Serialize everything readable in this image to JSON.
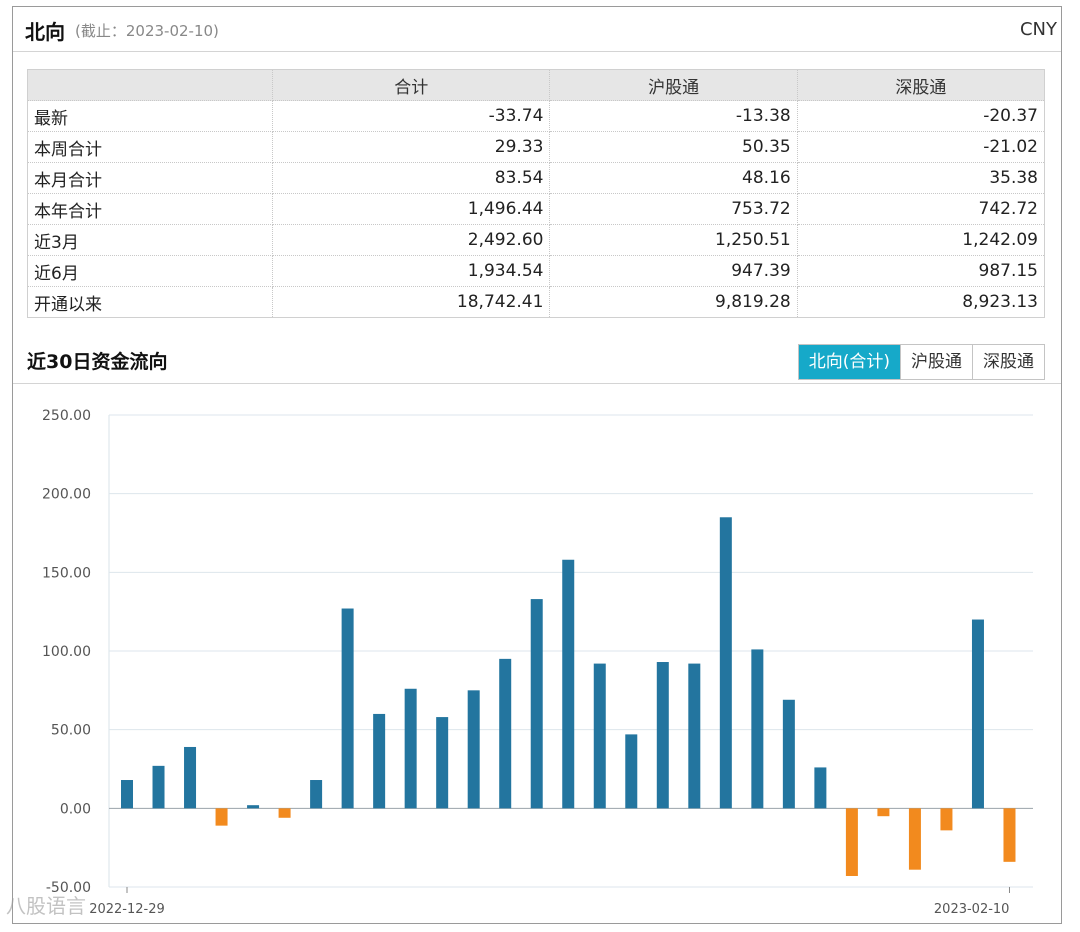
{
  "header": {
    "title": "北向",
    "subtitle": "(截止：2023-02-10)",
    "currency": "CNY"
  },
  "summary": {
    "columns": [
      "",
      "合计",
      "沪股通",
      "深股通"
    ],
    "rows": [
      {
        "label": "最新",
        "values": [
          "-33.74",
          "-13.38",
          "-20.37"
        ]
      },
      {
        "label": "本周合计",
        "values": [
          "29.33",
          "50.35",
          "-21.02"
        ]
      },
      {
        "label": "本月合计",
        "values": [
          "83.54",
          "48.16",
          "35.38"
        ]
      },
      {
        "label": "本年合计",
        "values": [
          "1,496.44",
          "753.72",
          "742.72"
        ]
      },
      {
        "label": "近3月",
        "values": [
          "2,492.60",
          "1,250.51",
          "1,242.09"
        ]
      },
      {
        "label": "近6月",
        "values": [
          "1,934.54",
          "947.39",
          "987.15"
        ]
      },
      {
        "label": "开通以来",
        "values": [
          "18,742.41",
          "9,819.28",
          "8,923.13"
        ]
      }
    ]
  },
  "section_title": "近30日资金流向",
  "tabs": [
    "北向(合计)",
    "沪股通",
    "深股通"
  ],
  "active_tab": "北向(合计)",
  "watermark": "八股语言",
  "chart_data": {
    "type": "bar",
    "title": "",
    "xlabel": "",
    "ylabel": "",
    "ylim": [
      -50,
      250
    ],
    "yticks": [
      "250.00",
      "200.00",
      "150.00",
      "100.00",
      "50.00",
      "0.00",
      "-50.00"
    ],
    "x_tick_labels": [
      "2022-12-29",
      "2023-02-10"
    ],
    "colors": {
      "positive": "#23759f",
      "negative": "#f28a1e"
    },
    "grid": true,
    "values": [
      18,
      27,
      39,
      -11,
      2,
      -6,
      18,
      127,
      60,
      76,
      58,
      75,
      95,
      133,
      158,
      92,
      47,
      93,
      92,
      185,
      101,
      69,
      26,
      -43,
      -5,
      -39,
      -14,
      120,
      -34
    ]
  }
}
